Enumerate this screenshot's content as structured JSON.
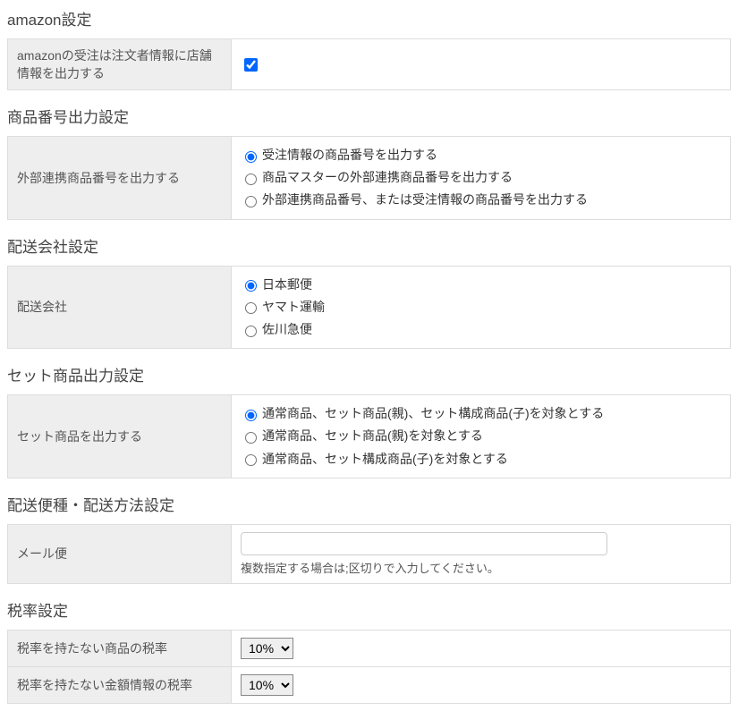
{
  "amazon": {
    "title": "amazon設定",
    "row_label": "amazonの受注は注文者情報に店舗情報を出力する",
    "checked": true
  },
  "product_number": {
    "title": "商品番号出力設定",
    "row_label": "外部連携商品番号を出力する",
    "options": [
      "受注情報の商品番号を出力する",
      "商品マスターの外部連携商品番号を出力する",
      "外部連携商品番号、または受注情報の商品番号を出力する"
    ],
    "selected_index": 0
  },
  "carrier": {
    "title": "配送会社設定",
    "row_label": "配送会社",
    "options": [
      "日本郵便",
      "ヤマト運輸",
      "佐川急便"
    ],
    "selected_index": 0
  },
  "set_product": {
    "title": "セット商品出力設定",
    "row_label": "セット商品を出力する",
    "options": [
      "通常商品、セット商品(親)、セット構成商品(子)を対象とする",
      "通常商品、セット商品(親)を対象とする",
      "通常商品、セット構成商品(子)を対象とする"
    ],
    "selected_index": 0
  },
  "shipping_method": {
    "title": "配送便種・配送方法設定",
    "row_label": "メール便",
    "input_value": "",
    "help": "複数指定する場合は;区切りで入力してください。"
  },
  "tax": {
    "title": "税率設定",
    "row1_label": "税率を持たない商品の税率",
    "row2_label": "税率を持たない金額情報の税率",
    "options": [
      "10%"
    ],
    "selected1": "10%",
    "selected2": "10%"
  }
}
